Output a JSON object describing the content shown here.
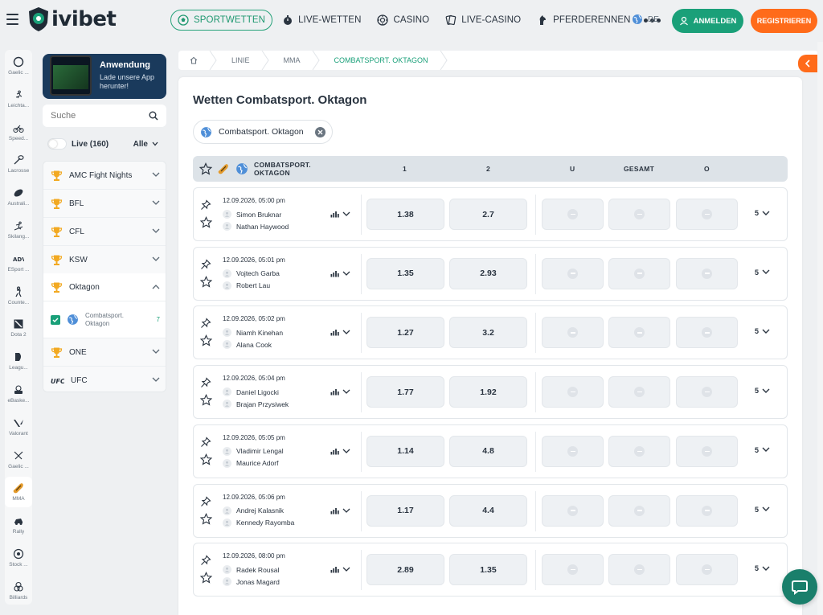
{
  "header": {
    "brand": "ivibet",
    "nav": [
      {
        "label": "SPORTWETTEN",
        "icon": "soccer-ball-icon",
        "active": true
      },
      {
        "label": "LIVE-WETTEN",
        "icon": "stopwatch-icon",
        "active": false
      },
      {
        "label": "CASINO",
        "icon": "casino-chip-icon",
        "active": false
      },
      {
        "label": "LIVE-CASINO",
        "icon": "cards-icon",
        "active": false
      },
      {
        "label": "PFERDERENNEN",
        "icon": "horse-head-icon",
        "active": false
      }
    ],
    "language": "DE",
    "login_label": "ANMELDEN",
    "register_label": "REGISTRIEREN"
  },
  "sport_rail": [
    {
      "label": "Gaelic ...",
      "icon": "hurling-ball-icon"
    },
    {
      "label": "Leichta...",
      "icon": "runner-icon"
    },
    {
      "label": "Speed...",
      "icon": "motorbike-icon"
    },
    {
      "label": "Lacrosse",
      "icon": "lacrosse-stick-icon"
    },
    {
      "label": "Australi...",
      "icon": "rugby-ball-icon"
    },
    {
      "label": "Skilang...",
      "icon": "skier-icon"
    },
    {
      "label": "ESport ...",
      "icon": "esport-logo-icon"
    },
    {
      "label": "Counte...",
      "icon": "counter-strike-icon"
    },
    {
      "label": "Dota 2",
      "icon": "dota-icon"
    },
    {
      "label": "Leagu...",
      "icon": "league-icon"
    },
    {
      "label": "eBaske...",
      "icon": "ebasketball-icon"
    },
    {
      "label": "Valorant",
      "icon": "valorant-icon"
    },
    {
      "label": "Gaelic ...",
      "icon": "hurling-sticks-icon"
    },
    {
      "label": "MMA",
      "icon": "mma-glove-icon",
      "active": true
    },
    {
      "label": "Rally",
      "icon": "rally-car-icon"
    },
    {
      "label": "Stock ...",
      "icon": "stock-car-icon"
    },
    {
      "label": "Billiards",
      "icon": "billiard-balls-icon"
    }
  ],
  "sidebar": {
    "app_banner": {
      "title": "Anwendung",
      "subtitle": "Lade unsere App herunter!"
    },
    "search_placeholder": "Suche",
    "live_label": "Live (160)",
    "filter_label": "Alle",
    "leagues": [
      {
        "name": "AMC Fight Nights",
        "icon": "trophy-icon"
      },
      {
        "name": "BFL",
        "icon": "trophy-icon"
      },
      {
        "name": "CFL",
        "icon": "trophy-icon"
      },
      {
        "name": "KSW",
        "icon": "trophy-icon"
      },
      {
        "name": "Oktagon",
        "icon": "trophy-icon",
        "expanded": true
      },
      {
        "name": "ONE",
        "icon": "trophy-icon"
      },
      {
        "name": "UFC",
        "icon": "ufc-logo-icon"
      }
    ],
    "sub_league": {
      "name": "Combatsport. Oktagon",
      "count": "7"
    }
  },
  "breadcrumb": [
    "LINIE",
    "MMA",
    "COMBATSPORT. OKTAGON"
  ],
  "main": {
    "title": "Wetten Combatsport. Oktagon",
    "filter_chip": "Combatsport. Oktagon",
    "table_header": {
      "competition": "COMBATSPORT. OKTAGON",
      "col_1": "1",
      "col_2": "2",
      "col_u": "U",
      "col_total": "GESAMT",
      "col_o": "O"
    },
    "matches": [
      {
        "time": "12.09.2026, 05:00 pm",
        "team1": "Simon Bruknar",
        "team2": "Nathan Haywood",
        "odd1": "1.38",
        "odd2": "2.7",
        "more": "5"
      },
      {
        "time": "12.09.2026, 05:01 pm",
        "team1": "Vojtech Garba",
        "team2": "Robert Lau",
        "odd1": "1.35",
        "odd2": "2.93",
        "more": "5"
      },
      {
        "time": "12.09.2026, 05:02 pm",
        "team1": "Niamh Kinehan",
        "team2": "Alana Cook",
        "odd1": "1.27",
        "odd2": "3.2",
        "more": "5"
      },
      {
        "time": "12.09.2026, 05:04 pm",
        "team1": "Daniel Ligocki",
        "team2": "Brajan Przysiwek",
        "odd1": "1.77",
        "odd2": "1.92",
        "more": "5"
      },
      {
        "time": "12.09.2026, 05:05 pm",
        "team1": "Vladimir Lengal",
        "team2": "Maurice Adorf",
        "odd1": "1.14",
        "odd2": "4.8",
        "more": "5"
      },
      {
        "time": "12.09.2026, 05:06 pm",
        "team1": "Andrej Kalasnik",
        "team2": "Kennedy Rayomba",
        "odd1": "1.17",
        "odd2": "4.4",
        "more": "5"
      },
      {
        "time": "12.09.2026, 08:00 pm",
        "team1": "Radek Rousal",
        "team2": "Jonas Magard",
        "odd1": "2.89",
        "odd2": "1.35",
        "more": "5"
      }
    ]
  },
  "colors": {
    "accent": "#1aa079",
    "register": "#ff6b1a",
    "chat": "#1a7f6b"
  }
}
